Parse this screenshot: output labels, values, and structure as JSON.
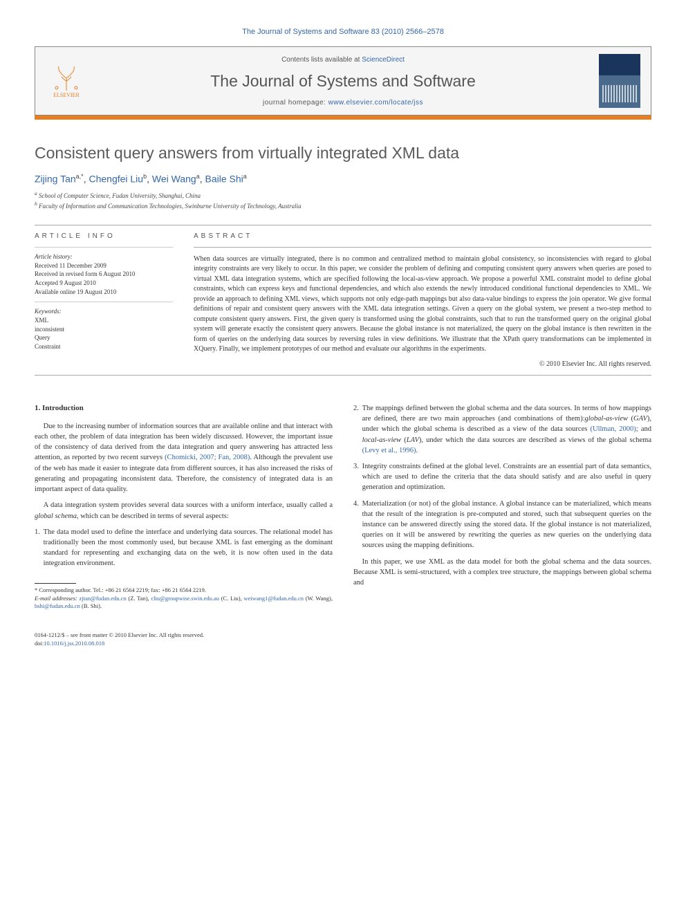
{
  "header": {
    "journal_ref": "The Journal of Systems and Software 83 (2010) 2566–2578",
    "contents_prefix": "Contents lists available at ",
    "contents_link": "ScienceDirect",
    "journal_title": "The Journal of Systems and Software",
    "homepage_prefix": "journal homepage: ",
    "homepage_url": "www.elsevier.com/locate/jss",
    "publisher_name": "ELSEVIER"
  },
  "article": {
    "title": "Consistent query answers from virtually integrated XML data",
    "authors_html": "Zijing Tan",
    "author1_name": "Zijing Tan",
    "author1_sup": "a,*",
    "author2_name": "Chengfei Liu",
    "author2_sup": "b",
    "author3_name": "Wei Wang",
    "author3_sup": "a",
    "author4_name": "Baile Shi",
    "author4_sup": "a",
    "sep": ", ",
    "affiliations": [
      {
        "sup": "a",
        "text": "School of Computer Science, Fudan University, Shanghai, China"
      },
      {
        "sup": "b",
        "text": "Faculty of Information and Communication Technologies, Swinburne University of Technology, Australia"
      }
    ]
  },
  "article_info": {
    "heading": "article info",
    "history_heading": "Article history:",
    "history": [
      "Received 11 December 2009",
      "Received in revised form 6 August 2010",
      "Accepted 9 August 2010",
      "Available online 19 August 2010"
    ],
    "keywords_heading": "Keywords:",
    "keywords": [
      "XML",
      "inconsistent",
      "Query",
      "Constraint"
    ]
  },
  "abstract": {
    "heading": "abstract",
    "text": "When data sources are virtually integrated, there is no common and centralized method to maintain global consistency, so inconsistencies with regard to global integrity constraints are very likely to occur. In this paper, we consider the problem of defining and computing consistent query answers when queries are posed to virtual XML data integration systems, which are specified following the local-as-view approach. We propose a powerful XML constraint model to define global constraints, which can express keys and functional dependencies, and which also extends the newly introduced conditional functional dependencies to XML. We provide an approach to defining XML views, which supports not only edge-path mappings but also data-value bindings to express the join operator. We give formal definitions of repair and consistent query answers with the XML data integration settings. Given a query on the global system, we present a two-step method to compute consistent query answers. First, the given query is transformed using the global constraints, such that to run the transformed query on the original global system will generate exactly the consistent query answers. Because the global instance is not materialized, the query on the global instance is then rewritten in the form of queries on the underlying data sources by reversing rules in view definitions. We illustrate that the XPath query transformations can be implemented in XQuery. Finally, we implement prototypes of our method and evaluate our algorithms in the experiments.",
    "copyright": "© 2010 Elsevier Inc. All rights reserved."
  },
  "body": {
    "sec1_heading": "1. Introduction",
    "p1": "Due to the increasing number of information sources that are available online and that interact with each other, the problem of data integration has been widely discussed. However, the important issue of the consistency of data derived from the data integration and query answering has attracted less attention, as reported by two recent surveys ",
    "p1_c1": "(Chomicki, 2007; Fan, 2008)",
    "p1_b": ". Although the prevalent use of the web has made it easier to integrate data from different sources, it has also increased the risks of generating and propagating inconsistent data. Therefore, the consistency of integrated data is an important aspect of data quality.",
    "p2a": "A data integration system provides several data sources with a uniform interface, usually called a ",
    "p2_em": "global schema",
    "p2b": ", which can be described in terms of several aspects:",
    "li1": "The data model used to define the interface and underlying data sources. The relational model has traditionally been the most commonly used, but because XML is fast emerging as the dominant standard for representing and exchanging data on the web, it is now often used in the data integration environment.",
    "li2a": "The mappings defined between the global schema and the data sources. In terms of how mappings are defined, there are two main approaches (and combinations of them):",
    "li2_em1": "global-as-view",
    "li2b": " (",
    "li2_em1b": "GAV",
    "li2c": "), under which the global schema is described as a view of the data sources ",
    "li2_cite1": "(Ullman, 2000)",
    "li2d": "; and ",
    "li2_em2": "local-as-view",
    "li2e": " (",
    "li2_em2b": "LAV",
    "li2f": "), under which the data sources are described as views of the global schema ",
    "li2_cite2": "(Levy et al., 1996)",
    "li2g": ".",
    "li3": "Integrity constraints defined at the global level. Constraints are an essential part of data semantics, which are used to define the criteria that the data should satisfy and are also useful in query generation and optimization.",
    "li4": "Materialization (or not) of the global instance. A global instance can be materialized, which means that the result of the integration is pre-computed and stored, such that subsequent queries on the instance can be answered directly using the stored data. If the global instance is not materialized, queries on it will be answered by rewriting the queries as new queries on the underlying data sources using the mapping definitions.",
    "p3": "In this paper, we use XML as the data model for both the global schema and the data sources. Because XML is semi-structured, with a complex tree structure, the mappings between global schema and"
  },
  "footnotes": {
    "corr_prefix": "* Corresponding author. Tel.: +86 21 6564 2219; fax: +86 21 6564 2219.",
    "email_label": "E-mail addresses:",
    "e1": "zjtan@fudan.edu.cn",
    "n1": " (Z. Tan), ",
    "e2": "cliu@groupwise.swin.edu.au",
    "n2": " (C. Liu), ",
    "e3": "weiwang1@fudan.edu.cn",
    "n3": " (W. Wang), ",
    "e4": "bshi@fudan.edu.cn",
    "n4": " (B. Shi)."
  },
  "bottom": {
    "line1": "0164-1212/$ – see front matter © 2010 Elsevier Inc. All rights reserved.",
    "doi_label": "doi:",
    "doi": "10.1016/j.jss.2010.08.018"
  }
}
